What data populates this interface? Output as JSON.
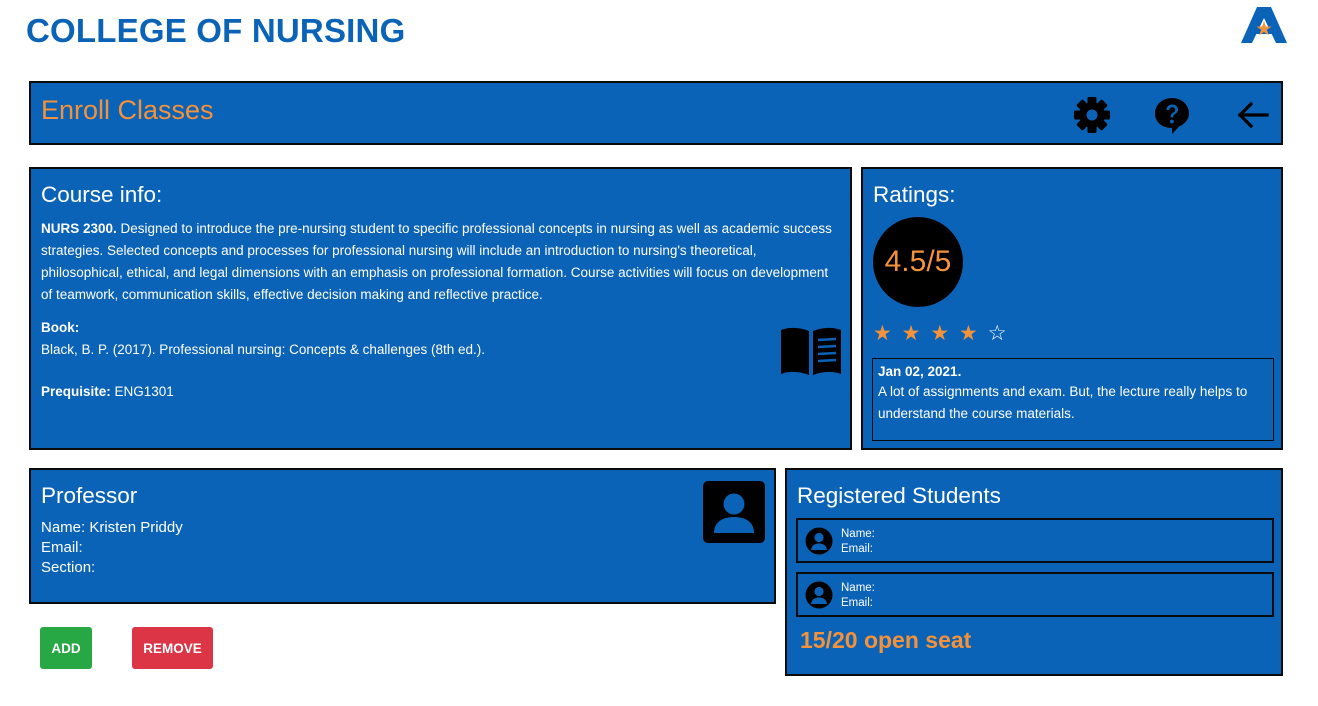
{
  "app": {
    "title": "COLLEGE OF NURSING"
  },
  "header": {
    "title": "Enroll Classes",
    "icons": [
      "gear-icon",
      "help-icon",
      "back-arrow-icon"
    ]
  },
  "course": {
    "heading": "Course info:",
    "code": "NURS 2300.",
    "description": " Designed to introduce the pre-nursing student to specific professional concepts in nursing as well as academic success strategies. Selected concepts and processes for professional nursing will include an introduction to nursing's theoretical, philosophical, ethical, and legal dimensions with an emphasis on professional formation. Course activities will focus on development of teamwork, communication skills, effective decision making and reflective practice.",
    "book_label": "Book:",
    "book": "Black, B. P. (2017). Professional nursing: Concepts & challenges (8th ed.).",
    "prereq_label": "Prequisite:",
    "prereq_value": " ENG1301",
    "icon": "open-book-icon"
  },
  "ratings": {
    "heading": "Ratings:",
    "score": "4.5/5",
    "stars_filled": 4,
    "stars_total": 5,
    "review": {
      "date": "Jan 02, 2021.",
      "text": "A lot of assignments and exam. But, the lecture really helps to understand the course materials."
    }
  },
  "professor": {
    "heading": "Professor",
    "name": "Name: Kristen Priddy",
    "email": "Email:",
    "section": "Section:",
    "icon": "contact-card-icon"
  },
  "students": {
    "heading": "Registered Students",
    "items": [
      {
        "name": "Name:",
        "email": "Email:"
      },
      {
        "name": "Name:",
        "email": "Email:"
      }
    ],
    "open_seats": "15/20 open seat"
  },
  "actions": {
    "add_label": "ADD",
    "remove_label": "REMOVE"
  },
  "colors": {
    "primary_blue": "#0a63b6",
    "accent_orange": "#f3923a",
    "add_green": "#28a745",
    "remove_red": "#dc3545"
  }
}
